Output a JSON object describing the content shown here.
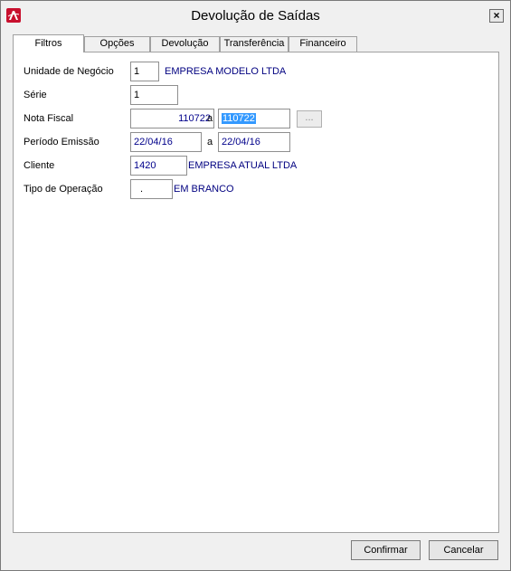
{
  "window": {
    "title": "Devolução de Saídas",
    "close_label": "×"
  },
  "tabs": [
    {
      "label": "Filtros"
    },
    {
      "label": "Opções"
    },
    {
      "label": "Devolução"
    },
    {
      "label": "Transferência"
    },
    {
      "label": "Financeiro"
    }
  ],
  "form": {
    "unidade": {
      "label": "Unidade de Negócio",
      "value": "1",
      "description": "EMPRESA MODELO LTDA"
    },
    "serie": {
      "label": "Série",
      "value": "1"
    },
    "nota_fiscal": {
      "label": "Nota Fiscal",
      "from": "110722",
      "sep": "a",
      "to": "110722",
      "browse_label": "..."
    },
    "periodo": {
      "label": "Período Emissão",
      "from": "22/04/16",
      "sep": "a",
      "to": "22/04/16"
    },
    "cliente": {
      "label": "Cliente",
      "value": "1420",
      "description": "EMPRESA ATUAL LTDA"
    },
    "tipo_operacao": {
      "label": "Tipo de Operação",
      "value": ".",
      "description": "EM BRANCO"
    }
  },
  "buttons": {
    "confirm": "Confirmar",
    "cancel": "Cancelar"
  }
}
